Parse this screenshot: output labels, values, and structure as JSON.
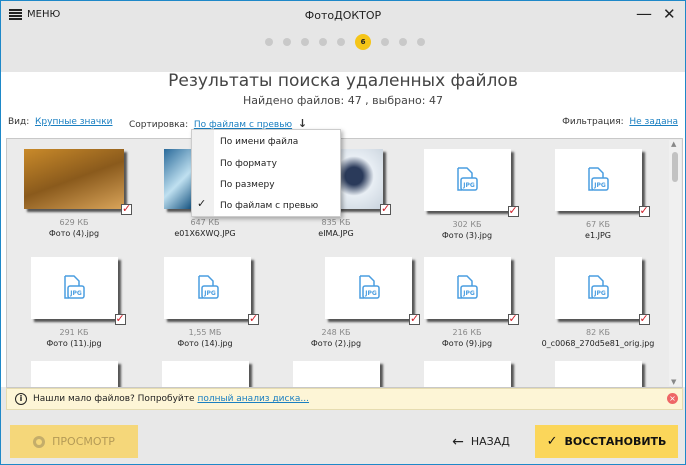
{
  "app": {
    "title": "ФотоДОКТОР",
    "menu_label": "МЕНЮ",
    "minimize": "—",
    "close": "✕"
  },
  "steps": {
    "total": 9,
    "current": 6,
    "current_label": "6"
  },
  "page": {
    "title": "Результаты поиска удаленных файлов",
    "subtitle": "Найдено файлов: 47 , выбрано: 47"
  },
  "toolbar": {
    "view_label": "Вид:",
    "view_value": "Крупные значки",
    "sort_label": "Сортировка:",
    "sort_value": "По файлам с превью",
    "sort_dir": "↓",
    "filter_label": "Фильтрация:",
    "filter_value": "Не задана"
  },
  "sort_menu": {
    "items": [
      "По имени файла",
      "По формату",
      "По размеру",
      "По файлам с превью"
    ],
    "checked": "✓"
  },
  "files": [
    {
      "size": "629 КБ",
      "name": "Фото (4).jpg",
      "preview": "photo-couple-bikes",
      "checked": true
    },
    {
      "size": "647 КБ",
      "name": "e01X6XWQ.JPG",
      "preview": "photo-winter-trees",
      "checked": true
    },
    {
      "size": "835 КБ",
      "name": "eIMA.JPG",
      "preview": "photo-child-snow",
      "checked": true
    },
    {
      "size": "302 КБ",
      "name": "Фото (3).jpg",
      "preview": "jpg-icon",
      "checked": true
    },
    {
      "size": "67 КБ",
      "name": "e1.JPG",
      "preview": "jpg-icon",
      "checked": true
    },
    {
      "size": "291 КБ",
      "name": "Фото (11).jpg",
      "preview": "jpg-icon",
      "checked": true
    },
    {
      "size": "1,55 МБ",
      "name": "Фото (14).jpg",
      "preview": "jpg-icon",
      "checked": true
    },
    {
      "size": "248 КБ",
      "name": "Фото (2).jpg",
      "preview": "jpg-icon",
      "checked": true
    },
    {
      "size": "216 КБ",
      "name": "Фото (9).jpg",
      "preview": "jpg-icon",
      "checked": true
    },
    {
      "size": "82 КБ",
      "name": "0_c0068_270d5e81_orig.jpg",
      "preview": "jpg-icon",
      "checked": true
    }
  ],
  "info": {
    "text": "Нашли мало файлов? Попробуйте ",
    "link": "полный анализ диска...",
    "icon": "i"
  },
  "footer": {
    "preview": "ПРОСМОТР",
    "back": "НАЗАД",
    "restore": "ВОССТАНОВИТЬ"
  },
  "colors": {
    "accent": "#f5c518",
    "link": "#1a7fc1",
    "border": "#1e88c8"
  }
}
